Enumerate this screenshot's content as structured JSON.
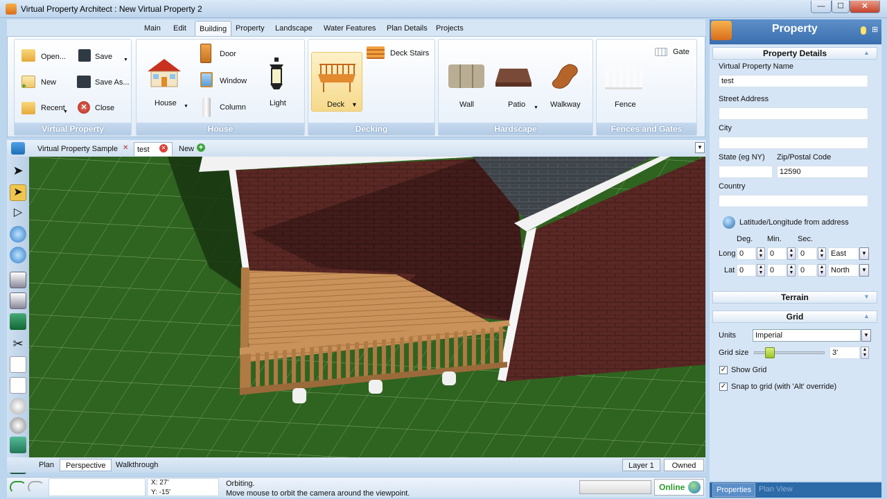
{
  "window": {
    "title": "Virtual Property Architect : New Virtual Property 2",
    "min": "—",
    "max": "☐",
    "close": "✕"
  },
  "menu": {
    "tabs": [
      "Main",
      "Edit",
      "Building",
      "Property",
      "Landscape",
      "Water Features",
      "Plan Details",
      "Projects"
    ],
    "active": "Building"
  },
  "ribbon": {
    "virtual_property": {
      "open": "Open...",
      "save": "Save",
      "new": "New",
      "save_as": "Save As...",
      "recent": "Recent",
      "close": "Close",
      "group": "Virtual Property"
    },
    "house": {
      "house": "House",
      "door": "Door",
      "window": "Window",
      "column": "Column",
      "light": "Light",
      "group": "House"
    },
    "decking": {
      "deck": "Deck",
      "deck_stairs": "Deck Stairs",
      "group": "Decking"
    },
    "hardscape": {
      "wall": "Wall",
      "patio": "Patio",
      "walkway": "Walkway",
      "group": "Hardscape"
    },
    "fences": {
      "gate": "Gate",
      "fence": "Fence",
      "group": "Fences and Gates"
    }
  },
  "doc_tabs": {
    "sample": "Virtual Property Sample",
    "test": "test",
    "new": "New"
  },
  "view_modes": {
    "plan": "Plan",
    "perspective": "Perspective",
    "walkthrough": "Walkthrough",
    "layer": "Layer 1",
    "owned": "Owned"
  },
  "status": {
    "x": "X:  27'",
    "y": "Y:  -15'",
    "mode": "Orbiting.",
    "hint": "Move mouse to orbit the camera around the viewpoint.",
    "online": "Online"
  },
  "panel": {
    "title": "Property",
    "details_header": "Property Details",
    "name_label": "Virtual Property Name",
    "name_value": "test",
    "street_label": "Street Address",
    "city_label": "City",
    "state_label": "State (eg NY)",
    "zip_label": "Zip/Postal Code",
    "zip_value": "12590",
    "country_label": "Country",
    "latlong_label": "Latitude/Longitude from address",
    "deg": "Deg.",
    "min": "Min.",
    "sec": "Sec.",
    "long_label": "Long",
    "lat_label": "Lat",
    "long_deg": "0",
    "long_min": "0",
    "long_sec": "0",
    "long_dir": "East",
    "lat_deg": "0",
    "lat_min": "0",
    "lat_sec": "0",
    "lat_dir": "North",
    "terrain_header": "Terrain",
    "grid_header": "Grid",
    "units_label": "Units",
    "units_value": "Imperial",
    "grid_size_label": "Grid size",
    "grid_size_value": "3'",
    "grid_size_slider_fraction": 0.25,
    "show_grid": "Show Grid",
    "snap_grid": "Snap to grid (with 'Alt' override)",
    "tab_properties": "Properties",
    "tab_plan_view": "Plan View"
  },
  "colors": {
    "accent": "#3a6eae",
    "ribbon_group": "#b3cbe5",
    "grass": "#2c5c1d",
    "brick": "#5a2a26",
    "deck": "#c9925a",
    "online": "#2a9a2a"
  }
}
